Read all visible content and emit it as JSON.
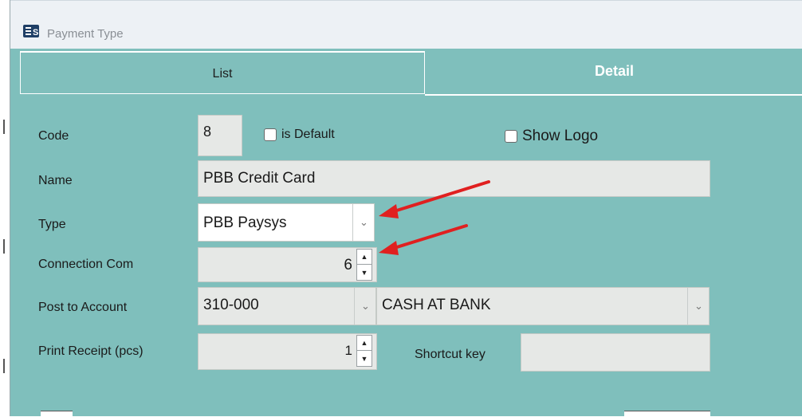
{
  "window": {
    "title": "Payment Type"
  },
  "tabs": {
    "list": "List",
    "detail": "Detail"
  },
  "form": {
    "code": {
      "label": "Code",
      "value": "8"
    },
    "is_default": {
      "label": "is Default",
      "checked": false
    },
    "show_logo": {
      "label": "Show Logo",
      "checked": false
    },
    "name": {
      "label": "Name",
      "value": "PBB Credit Card"
    },
    "type": {
      "label": "Type",
      "value": "PBB Paysys"
    },
    "connection_com": {
      "label": "Connection Com",
      "value": "6"
    },
    "post_to_account": {
      "label": "Post to Account",
      "code": "310-000",
      "name": "CASH AT BANK"
    },
    "print_receipt": {
      "label": "Print Receipt (pcs)",
      "value": "1"
    },
    "shortcut_key": {
      "label": "Shortcut key",
      "value": ""
    }
  },
  "annotations": {
    "arrow_color": "#e02020"
  },
  "colors": {
    "panel_bg": "#7fbfbc",
    "titlebar_bg": "#edf1f5"
  }
}
